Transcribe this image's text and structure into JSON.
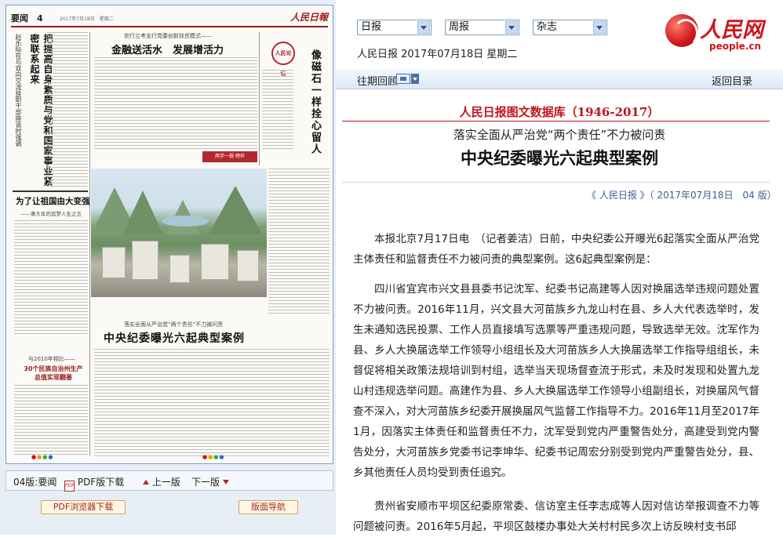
{
  "paper_preview": {
    "section": "要闻　4",
    "date_line": "2017年7月18日　星期二",
    "masthead": "人民日報",
    "seal_text": "人民论坛",
    "headlines": {
      "left_vertical": "把提高自身素质与党和国家事业紧密联系起来",
      "left_sub_vertical": "赵乐际在与双向交流挂职干部座谈时强调",
      "center_kicker": "农行兰考支行党委创新扶贫模式——",
      "center_title": "金融送活水　发展增活力",
      "right_vertical": "像磁石一样拴心留人",
      "left_mid": "为了让祖国由大变强",
      "left_mid_sub": "——黄大年的追梦人生之五",
      "red_tag": "两学一做·榜样",
      "bottom_kicker": "落实全面从严治党“两个责任”不力被问责",
      "bottom_title": "中央纪委曝光六起典型案例",
      "left_bottom_kicker": "与2010年相比——",
      "left_bottom_title": "30个民族自治州生产总值实现翻番"
    }
  },
  "pager": {
    "page_label": "04版:要闻",
    "pdf_download": "PDF版下载",
    "prev": "上一版",
    "next": "下一版",
    "pdf_browser": "PDF浏览器下载",
    "page_nav": "版面导航"
  },
  "toolbar": {
    "select_daily": "日报",
    "select_weekly": "周报",
    "select_magazine": "杂志",
    "paper_date": "人民日报 2017年07月18日 星期二",
    "logo_text": "人民网",
    "logo_url": "people.cn"
  },
  "nav": {
    "past_issues": "往期回顾",
    "back_to_index": "返回目录"
  },
  "article": {
    "db_title": "人民日报图文数据库（1946-2017）",
    "subtitle": "落实全面从严治党“两个责任”不力被问责",
    "title": "中央纪委曝光六起典型案例",
    "source": "《 人民日报 》（ 2017年07月18日　04 版）",
    "paragraphs": [
      "本报北京7月17日电　（记者姜洁）日前，中央纪委公开曝光6起落实全面从严治党主体责任和监督责任不力被问责的典型案例。这6起典型案例是：",
      "四川省宜宾市兴文县县委书记沈军、纪委书记高建等人因对换届选举违规问题处置不力被问责。2016年11月，兴文县大河苗族乡九龙山村在县、乡人大代表选举时，发生未通知选民投票、工作人员直接填写选票等严重违规问题，导致选举无效。沈军作为县、乡人大换届选举工作领导小组组长及大河苗族乡人大换届选举工作指导组组长，未督促将相关政策法规培训到村组，选举当天现场督查流于形式，未及时发现和处置九龙山村违规选举问题。高建作为县、乡人大换届选举工作领导小组副组长，对换届风气督查不深入，对大河苗族乡纪委开展换届风气监督工作指导不力。2016年11月至2017年1月，因落实主体责任和监督责任不力，沈军受到党内严重警告处分，高建受到党内警告处分，大河苗族乡党委书记李坤华、纪委书记周宏分别受到党内严重警告处分，县、乡其他责任人员均受到责任追究。",
      "贵州省安顺市平坝区纪委原常委、信访室主任李志成等人因对信访举报调查不力等问题被问责。2016年5月起，平坝区鼓楼办事处大关村村民多次上访反映村支书邱"
    ]
  },
  "colors": {
    "accent_red": "#c1131b",
    "link_blue": "#3d5f95",
    "frame_blue": "#7aa0c8"
  }
}
